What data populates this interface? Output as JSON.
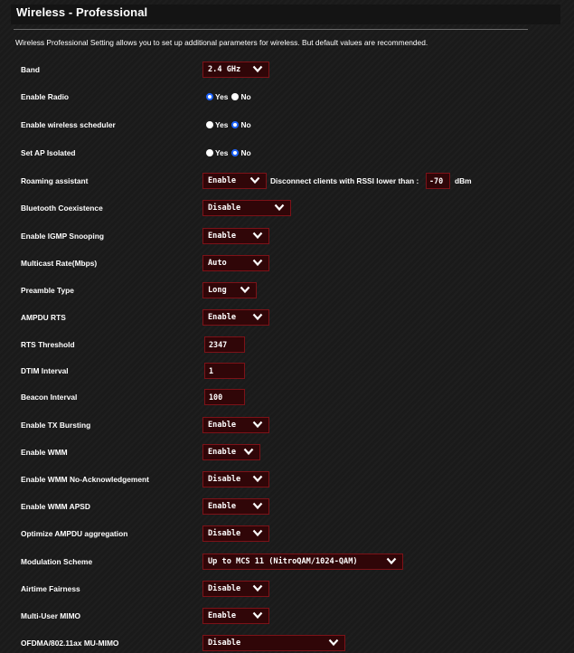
{
  "header": {
    "title": "Wireless - Professional",
    "description": "Wireless Professional Setting allows you to set up additional parameters for wireless. But default values are recommended."
  },
  "settings": {
    "band": {
      "label": "Band",
      "value": "2.4 GHz"
    },
    "enable_radio": {
      "label": "Enable Radio",
      "yes": "Yes",
      "no": "No",
      "selected": "Yes"
    },
    "wireless_scheduler": {
      "label": "Enable wireless scheduler",
      "yes": "Yes",
      "no": "No",
      "selected": "No"
    },
    "ap_isolated": {
      "label": "Set AP Isolated",
      "yes": "Yes",
      "no": "No",
      "selected": "No"
    },
    "roaming_assistant": {
      "label": "Roaming assistant",
      "value": "Enable",
      "rssi_text": "Disconnect clients with RSSI lower than :",
      "rssi_value": "-70",
      "unit": "dBm"
    },
    "bluetooth_coexistence": {
      "label": "Bluetooth Coexistence",
      "value": "Disable"
    },
    "igmp_snooping": {
      "label": "Enable IGMP Snooping",
      "value": "Enable"
    },
    "multicast_rate": {
      "label": "Multicast Rate(Mbps)",
      "value": "Auto"
    },
    "preamble_type": {
      "label": "Preamble Type",
      "value": "Long"
    },
    "ampdu_rts": {
      "label": "AMPDU RTS",
      "value": "Enable"
    },
    "rts_threshold": {
      "label": "RTS Threshold",
      "value": "2347"
    },
    "dtim_interval": {
      "label": "DTIM Interval",
      "value": "1"
    },
    "beacon_interval": {
      "label": "Beacon Interval",
      "value": "100"
    },
    "tx_bursting": {
      "label": "Enable TX Bursting",
      "value": "Enable"
    },
    "wmm": {
      "label": "Enable WMM",
      "value": "Enable"
    },
    "wmm_no_ack": {
      "label": "Enable WMM No-Acknowledgement",
      "value": "Disable"
    },
    "wmm_apsd": {
      "label": "Enable WMM APSD",
      "value": "Enable"
    },
    "ampdu_aggregation": {
      "label": "Optimize AMPDU aggregation",
      "value": "Disable"
    },
    "modulation_scheme": {
      "label": "Modulation Scheme",
      "value": "Up to MCS 11 (NitroQAM/1024-QAM)"
    },
    "airtime_fairness": {
      "label": "Airtime Fairness",
      "value": "Disable"
    },
    "mu_mimo": {
      "label": "Multi-User MIMO",
      "value": "Enable"
    },
    "ofdma": {
      "label": "OFDMA/802.11ax MU-MIMO",
      "value": "Disable"
    }
  },
  "icons": {
    "dropdown": "chevron-down-icon",
    "radio": "radio-button"
  },
  "colors": {
    "background": "#1b1b1b",
    "field_bg": "#300608",
    "field_border": "#7d1218",
    "radio_accent": "#1e64ff"
  }
}
